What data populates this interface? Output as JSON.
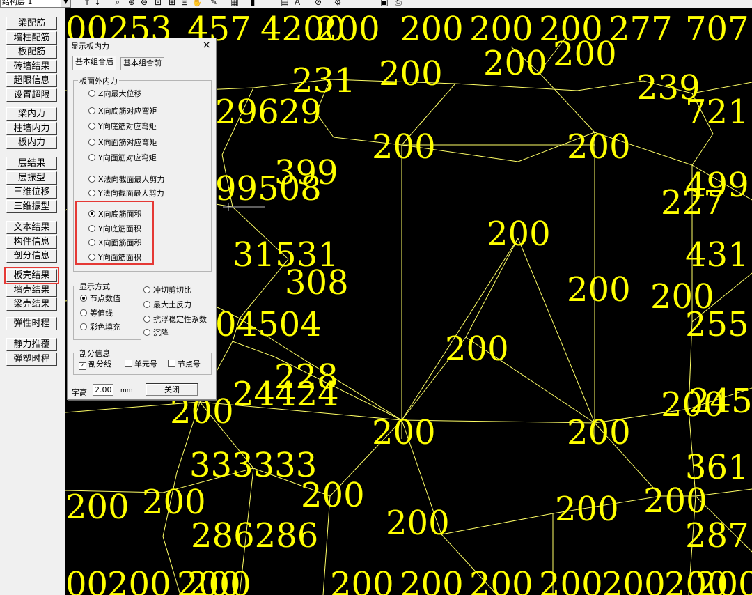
{
  "toolbar": {
    "layer_select_value": "结构层 1",
    "icons": [
      "arrow-up-icon",
      "arrow-down-icon",
      "zoom-icon",
      "zoom-in-icon",
      "zoom-out-icon",
      "zoom-window-icon",
      "zoom-all-icon",
      "zoom-previous-icon",
      "pan-icon",
      "edit-icon",
      "layer-icon",
      "chart-icon",
      "grid-icon",
      "text-icon",
      "clear-icon",
      "settings-icon",
      "save-icon",
      "print-icon"
    ]
  },
  "left_menu": {
    "groups": [
      [
        "梁配筋",
        "墙柱配筋",
        "板配筋",
        "砖墙结果",
        "超限信息",
        "设置超限"
      ],
      [
        "梁内力",
        "柱墙内力",
        "板内力"
      ],
      [
        "层结果",
        "层振型",
        "三维位移",
        "三维振型"
      ],
      [
        "文本结果",
        "构件信息",
        "剖分信息"
      ],
      [
        "板壳结果",
        "墙壳结果",
        "梁壳结果"
      ],
      [
        "弹性时程"
      ],
      [
        "静力推覆",
        "弹塑时程"
      ]
    ],
    "highlighted": "板壳结果"
  },
  "dialog": {
    "title": "显示板内力",
    "close_symbol": "×",
    "tabs": [
      "基本组合后",
      "基本组合前"
    ],
    "active_tab": "基本组合后",
    "force_group_label": "板面外内力",
    "force_options": [
      "Z向最大位移",
      "X向底筋对应弯矩",
      "Y向底筋对应弯矩",
      "X向面筋对应弯矩",
      "Y向面筋对应弯矩",
      "X法向截面最大剪力",
      "Y法向截面最大剪力",
      "X向底筋面积",
      "Y向底筋面积",
      "X向面筋面积",
      "Y向面筋面积"
    ],
    "force_selected": "X向底筋面积",
    "display_group_label": "显示方式",
    "display_options": [
      "节点数值",
      "等值线",
      "彩色填充"
    ],
    "display_selected": "节点数值",
    "extra_options": [
      "冲切剪切比",
      "最大土反力",
      "抗浮稳定性系数",
      "沉降"
    ],
    "mesh_group_label": "剖分信息",
    "mesh_checks": [
      {
        "label": "剖分线",
        "checked": true
      },
      {
        "label": "单元号",
        "checked": false
      },
      {
        "label": "节点号",
        "checked": false
      }
    ],
    "font_height_label": "字高",
    "font_height_value": "2.00",
    "font_height_unit": "mm",
    "close_button": "关闭"
  },
  "cad": {
    "line_color": "#ffff66",
    "text_color": "#ffff00",
    "background": "#000000",
    "labels": [
      "00253",
      "457",
      "4200",
      "200",
      "200",
      "200",
      "200",
      "277",
      "707",
      "231",
      "200",
      "200",
      "200",
      "239",
      "29629",
      "721",
      "200",
      "200",
      "99508",
      "399",
      "499",
      "227",
      "200",
      "31531",
      "431",
      "308",
      "200",
      "200",
      "04504",
      "255",
      "200",
      "228",
      "24424",
      "200",
      "245",
      "200",
      "200",
      "200",
      "333333",
      "361",
      "200",
      "200",
      "200",
      "200",
      "200",
      "200",
      "286286",
      "287",
      "00",
      "200",
      "200",
      "200",
      "200",
      "200",
      "200",
      "200",
      "200",
      "200",
      "200"
    ]
  }
}
